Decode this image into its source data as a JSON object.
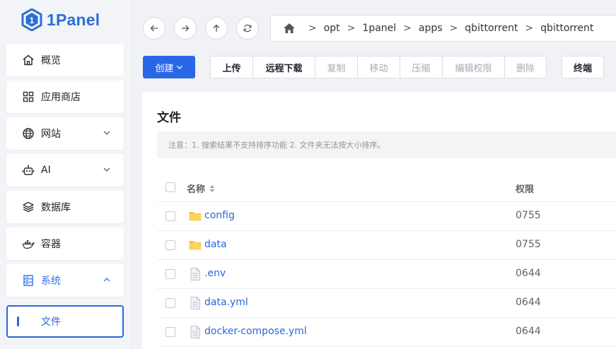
{
  "app": {
    "logo_text": "1Panel",
    "brand_color": "#2c6fd3",
    "accent_color": "#2a67e6"
  },
  "sidebar": {
    "items": [
      {
        "label": "概览",
        "icon": "home-icon"
      },
      {
        "label": "应用商店",
        "icon": "grid-icon"
      },
      {
        "label": "网站",
        "icon": "globe-icon",
        "expandable": true
      },
      {
        "label": "AI",
        "icon": "robot-icon",
        "expandable": true
      },
      {
        "label": "数据库",
        "icon": "layers-icon"
      },
      {
        "label": "容器",
        "icon": "docker-icon"
      },
      {
        "label": "系统",
        "icon": "server-icon",
        "expanded": true
      }
    ],
    "sub_item": {
      "label": "文件"
    }
  },
  "nav": {
    "back_icon": "arrow-left-icon",
    "forward_icon": "arrow-right-icon",
    "up_icon": "arrow-up-icon",
    "refresh_icon": "refresh-icon"
  },
  "breadcrumb": {
    "home_icon": "home-icon",
    "segments": [
      "opt",
      "1panel",
      "apps",
      "qbittorrent",
      "qbittorrent"
    ]
  },
  "toolbar": {
    "create": "创建",
    "upload": "上传",
    "remote_download": "远程下载",
    "copy": "复制",
    "move": "移动",
    "compress": "压缩",
    "edit_permission": "编辑权限",
    "delete": "删除",
    "terminal": "终端"
  },
  "panel": {
    "title": "文件",
    "notice": "注意：1. 搜索结果不支持排序功能 2. 文件夹无法按大小排序。"
  },
  "table": {
    "columns": {
      "name": "名称",
      "permission": "权限"
    },
    "rows": [
      {
        "name": "config",
        "type": "folder",
        "permission": "0755"
      },
      {
        "name": "data",
        "type": "folder",
        "permission": "0755"
      },
      {
        "name": ".env",
        "type": "file",
        "permission": "0644"
      },
      {
        "name": "data.yml",
        "type": "file",
        "permission": "0644"
      },
      {
        "name": "docker-compose.yml",
        "type": "file",
        "permission": "0644"
      }
    ]
  }
}
